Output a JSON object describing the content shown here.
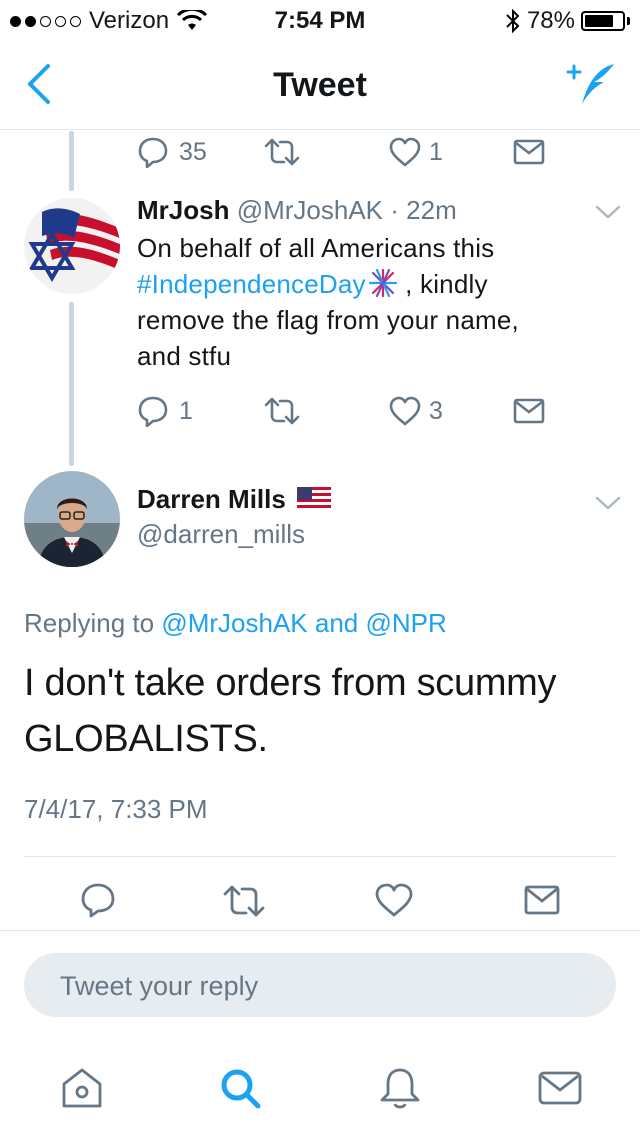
{
  "status_bar": {
    "carrier": "Verizon",
    "time": "7:54 PM",
    "battery": "78%",
    "battery_level": 0.78
  },
  "nav": {
    "title": "Tweet",
    "back_icon": "chevron-left-icon",
    "compose_icon": "compose-tweet-icon"
  },
  "parent_tweet_actions": {
    "replies": "35",
    "retweets": "",
    "likes": "1"
  },
  "reply_tweet": {
    "name": "MrJosh",
    "handle": "@MrJoshAK",
    "separator": "·",
    "time_ago": "22m",
    "text_before": "On behalf of all Americans this ",
    "hashtag": "#IndependenceDay",
    "hashtag_emoji": "fireworks-emoji",
    "text_after_line1": " , kindly",
    "text_line2": "remove the flag from your name,",
    "text_line3": "and stfu",
    "replies": "1",
    "likes": "3"
  },
  "main_tweet": {
    "name": "Darren Mills",
    "name_emoji": "us-flag-emoji",
    "handle": "@darren_mills",
    "replying_prefix": "Replying to",
    "replying_to_1": "@MrJoshAK",
    "replying_and": "and",
    "replying_to_2": "@NPR",
    "text_line1": "I don't take orders from scummy",
    "text_line2": "GLOBALISTS.",
    "timestamp": "7/4/17, 7:33 PM"
  },
  "reply_input": {
    "placeholder": "Tweet your reply"
  },
  "tab_bar": {
    "items": [
      "home-icon",
      "search-icon",
      "notifications-icon",
      "messages-icon"
    ]
  },
  "colors": {
    "accent": "#1da1f2",
    "muted": "#657786",
    "thread_line": "#ccd6dd",
    "divider": "#e1e8ed"
  }
}
